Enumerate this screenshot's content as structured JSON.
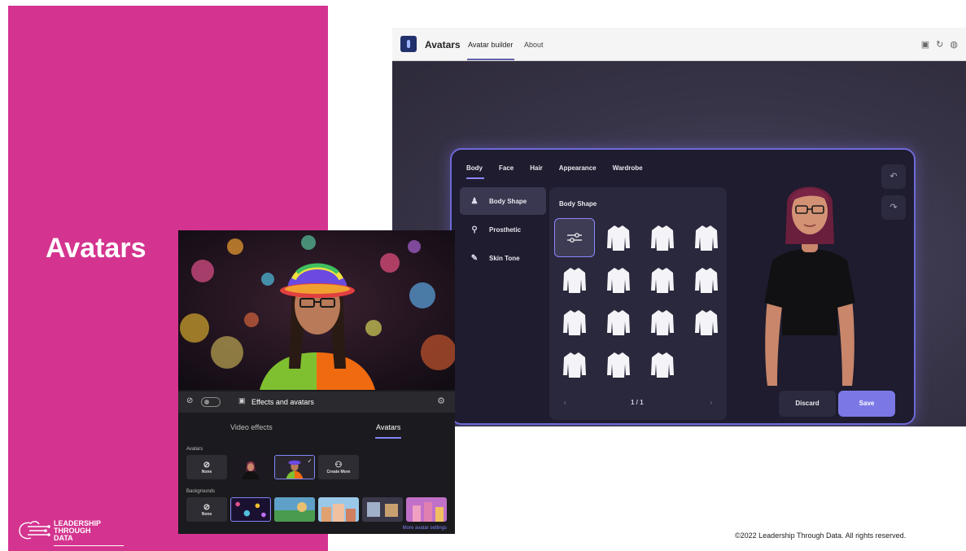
{
  "slide": {
    "title": "Avatars",
    "footer": "©2022 Leadership Through Data. All rights reserved.",
    "logo": {
      "line1": "LEADERSHIP",
      "line2": "THROUGH",
      "line3": "DATA"
    },
    "accent_color": "#d4348f"
  },
  "teams_app": {
    "app_name": "Avatars",
    "tabs": [
      {
        "label": "Avatar builder",
        "active": true
      },
      {
        "label": "About",
        "active": false
      }
    ],
    "builder": {
      "category_tabs": [
        "Body",
        "Face",
        "Hair",
        "Appearance",
        "Wardrobe"
      ],
      "active_category": "Body",
      "sidenav": [
        {
          "label": "Body Shape",
          "icon": "body-shape-icon",
          "active": true
        },
        {
          "label": "Prosthetic",
          "icon": "prosthetic-icon",
          "active": false
        },
        {
          "label": "Skin Tone",
          "icon": "skin-tone-icon",
          "active": false
        }
      ],
      "panel_title": "Body Shape",
      "shape_count": 14,
      "pager": {
        "prev": "‹",
        "page": "1 / 1",
        "next": "›"
      },
      "discard_label": "Discard",
      "save_label": "Save",
      "accent_color": "#7b78e6"
    }
  },
  "effects_panel": {
    "header_label": "Effects and avatars",
    "tabs": [
      "Video effects",
      "Avatars"
    ],
    "active_tab": "Avatars",
    "avatars_section_label": "Avatars",
    "avatar_tiles": [
      {
        "label": "None",
        "icon": "none-icon"
      },
      {
        "label": "",
        "icon": "avatar-thumbnail"
      },
      {
        "label": "",
        "icon": "avatar-thumbnail-selected"
      },
      {
        "label": "Create More",
        "icon": "create-more-icon"
      }
    ],
    "backgrounds_section_label": "Backgrounds",
    "background_none_label": "None",
    "more_link": "More avatar settings"
  }
}
